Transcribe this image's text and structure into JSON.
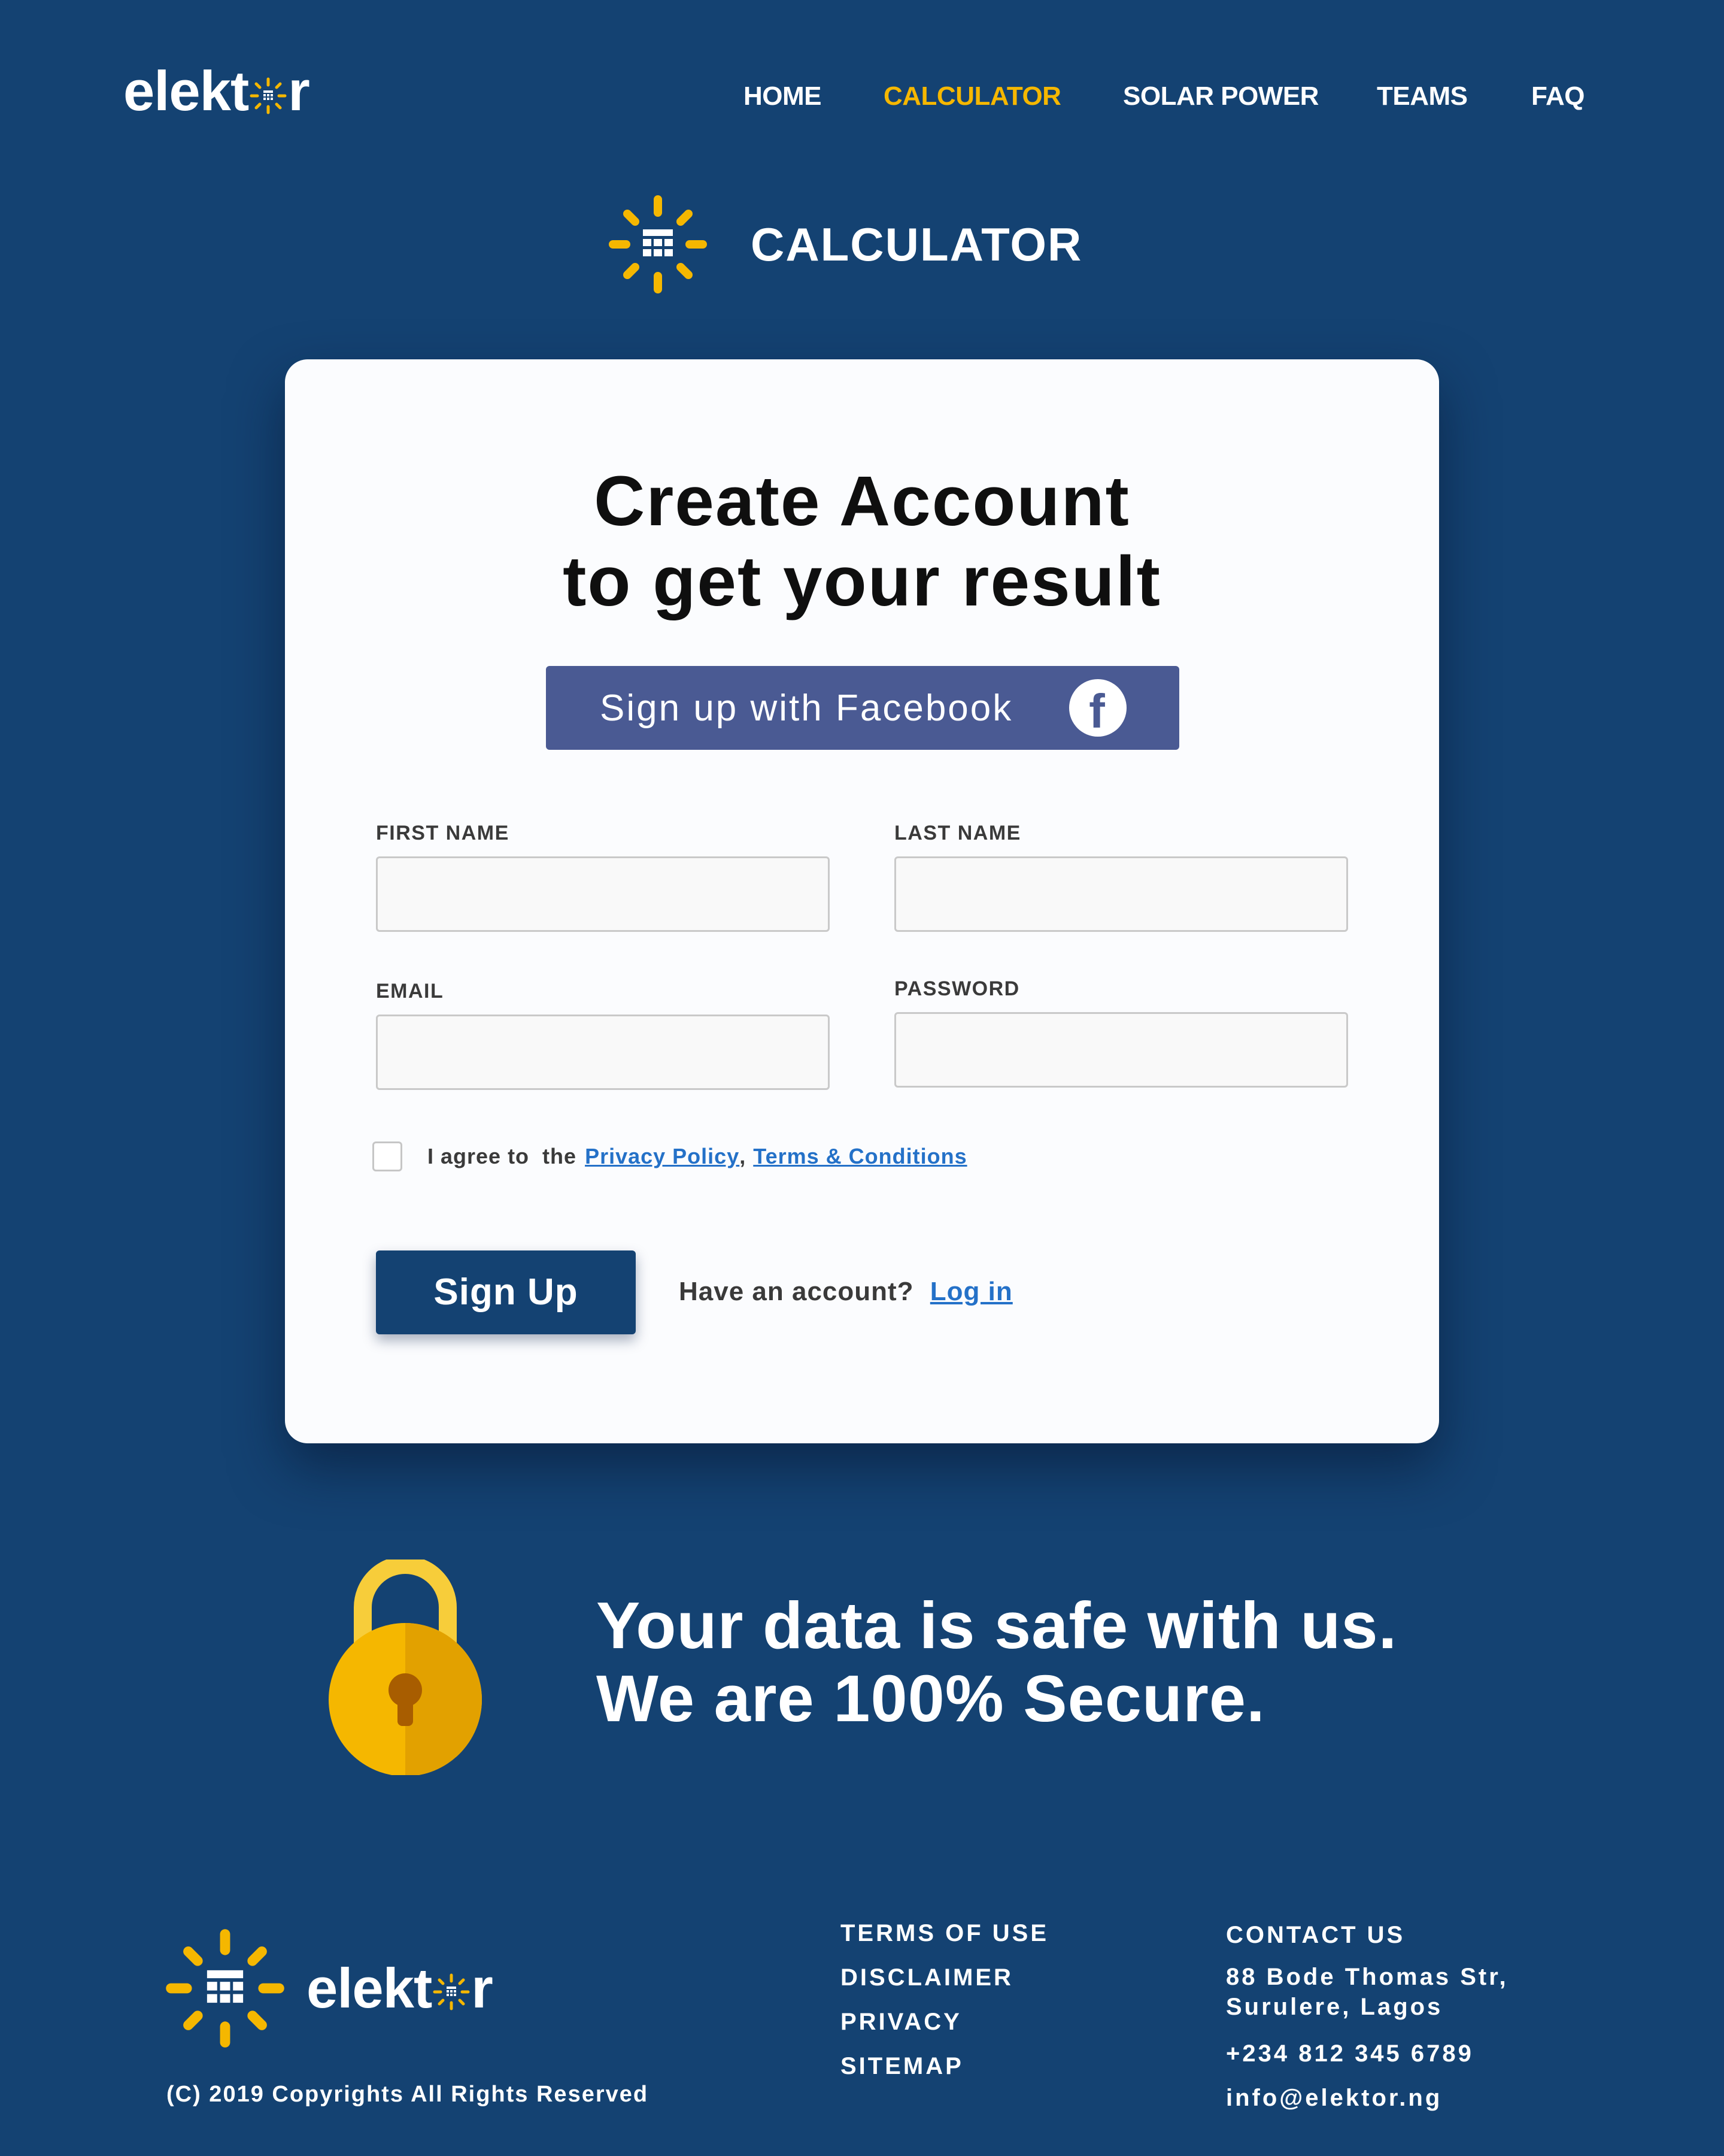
{
  "brand": {
    "name_prefix": "elekt",
    "name_suffix": "r",
    "accent": "#f5b700",
    "background": "#144272"
  },
  "nav": {
    "items": [
      {
        "label": "HOME"
      },
      {
        "label": "CALCULATOR",
        "active": true
      },
      {
        "label": "SOLAR POWER"
      },
      {
        "label": "TEAMS"
      },
      {
        "label": "FAQ"
      }
    ]
  },
  "calculator": {
    "title": "CALCULATOR",
    "icon": "calculator-sun-icon"
  },
  "form": {
    "title_line1": "Create Account",
    "title_line2": "to get your result",
    "facebook_label": "Sign up with Facebook",
    "facebook_icon": "facebook-icon",
    "first_name_label": "FIRST NAME",
    "last_name_label": "LAST NAME",
    "email_label": "EMAIL",
    "password_label": "PASSWORD",
    "agree_prefix": "I agree to  the",
    "privacy_link": "Privacy Policy",
    "separator": ",",
    "terms_link": "Terms & Conditions",
    "signup_label": "Sign Up",
    "have_account": "Have an account?",
    "login_link": "Log in",
    "facebook_color": "#4a5a93",
    "link_color": "#2471c8"
  },
  "secure": {
    "line1": "Your data is safe with us.",
    "line2": "We are 100% Secure.",
    "icon": "padlock-icon"
  },
  "footer": {
    "copyright": "(C) 2019 Copyrights All Rights Reserved",
    "links": [
      "TERMS OF USE",
      "DISCLAIMER",
      "PRIVACY",
      "SITEMAP"
    ],
    "contact_title": "CONTACT US",
    "address_line1": "88 Bode Thomas Str,",
    "address_line2": "Surulere, Lagos",
    "phone": "+234 812 345 6789",
    "email": "info@elektor.ng"
  }
}
